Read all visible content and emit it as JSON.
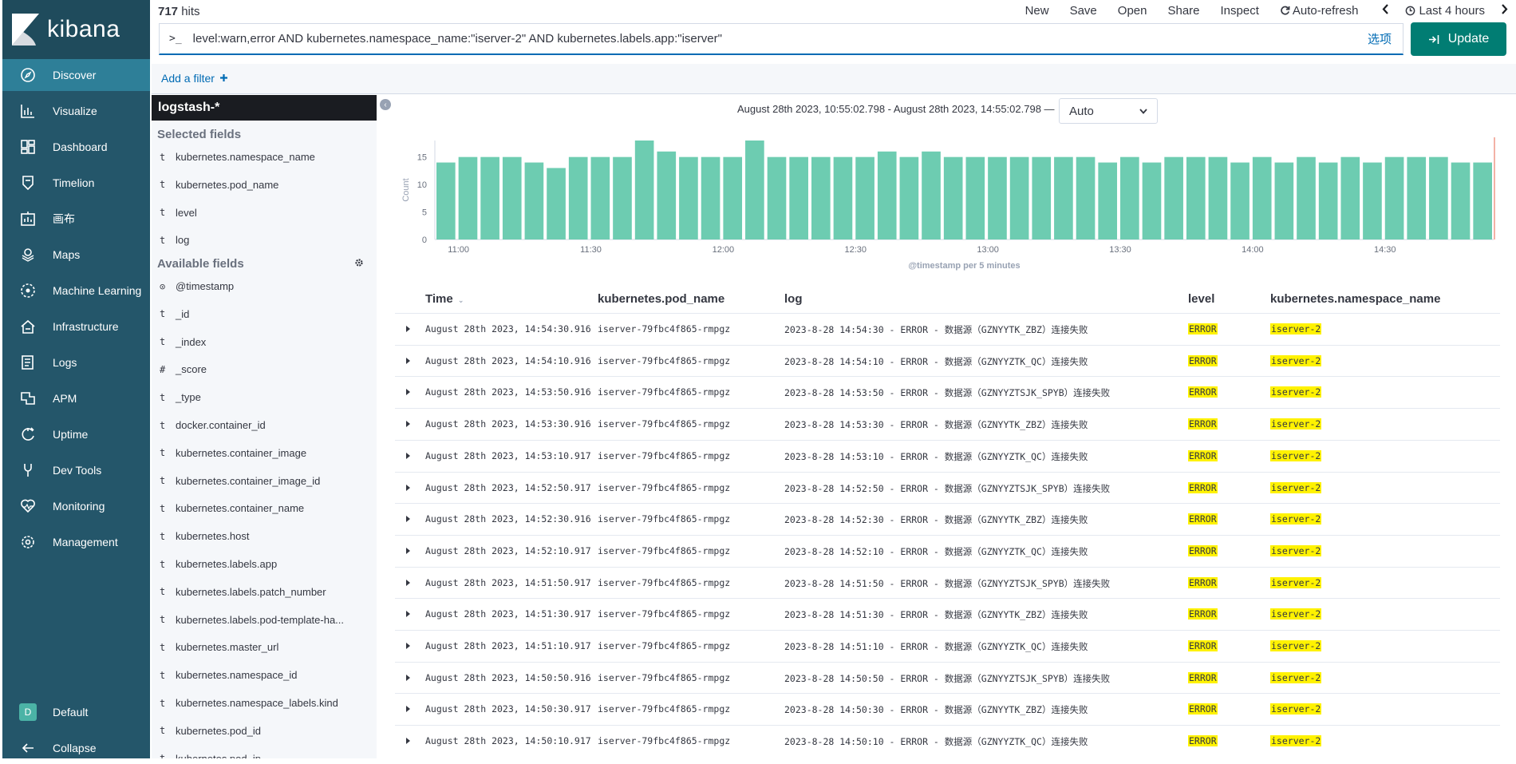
{
  "brand": "kibana",
  "nav": {
    "items": [
      {
        "label": "Discover",
        "icon": "compass-icon",
        "active": true
      },
      {
        "label": "Visualize",
        "icon": "visualize-icon"
      },
      {
        "label": "Dashboard",
        "icon": "dashboard-icon"
      },
      {
        "label": "Timelion",
        "icon": "timelion-icon"
      },
      {
        "label": "画布",
        "icon": "canvas-icon"
      },
      {
        "label": "Maps",
        "icon": "maps-icon"
      },
      {
        "label": "Machine Learning",
        "icon": "machine-learning-icon"
      },
      {
        "label": "Infrastructure",
        "icon": "infrastructure-icon"
      },
      {
        "label": "Logs",
        "icon": "logs-icon"
      },
      {
        "label": "APM",
        "icon": "apm-icon"
      },
      {
        "label": "Uptime",
        "icon": "uptime-icon"
      },
      {
        "label": "Dev Tools",
        "icon": "dev-tools-icon"
      },
      {
        "label": "Monitoring",
        "icon": "monitoring-icon"
      },
      {
        "label": "Management",
        "icon": "gear-icon"
      }
    ],
    "space_badge": "D",
    "space_label": "Default",
    "collapse_label": "Collapse"
  },
  "top": {
    "hits_count": "717",
    "hits_label": " hits",
    "menu": {
      "new": "New",
      "save": "Save",
      "open": "Open",
      "share": "Share",
      "inspect": "Inspect",
      "auto_refresh": "Auto-refresh",
      "time": "Last 4 hours"
    },
    "query_prompt": ">_",
    "query": "level:warn,error AND kubernetes.namespace_name:\"iserver-2\" AND kubernetes.labels.app:\"iserver\"",
    "options_label": "选项",
    "update_label": "Update",
    "add_filter": "Add a filter"
  },
  "sidebar": {
    "index_pattern": "logstash-*",
    "selected_title": "Selected fields",
    "selected": [
      {
        "type": "t",
        "name": "kubernetes.namespace_name"
      },
      {
        "type": "t",
        "name": "kubernetes.pod_name"
      },
      {
        "type": "t",
        "name": "level"
      },
      {
        "type": "t",
        "name": "log"
      }
    ],
    "available_title": "Available fields",
    "available": [
      {
        "type": "⊙",
        "name": "@timestamp"
      },
      {
        "type": "t",
        "name": "_id"
      },
      {
        "type": "t",
        "name": "_index"
      },
      {
        "type": "#",
        "name": "_score"
      },
      {
        "type": "t",
        "name": "_type"
      },
      {
        "type": "t",
        "name": "docker.container_id"
      },
      {
        "type": "t",
        "name": "kubernetes.container_image"
      },
      {
        "type": "t",
        "name": "kubernetes.container_image_id"
      },
      {
        "type": "t",
        "name": "kubernetes.container_name"
      },
      {
        "type": "t",
        "name": "kubernetes.host"
      },
      {
        "type": "t",
        "name": "kubernetes.labels.app"
      },
      {
        "type": "t",
        "name": "kubernetes.labels.patch_number"
      },
      {
        "type": "t",
        "name": "kubernetes.labels.pod-template-ha..."
      },
      {
        "type": "t",
        "name": "kubernetes.master_url"
      },
      {
        "type": "t",
        "name": "kubernetes.namespace_id"
      },
      {
        "type": "t",
        "name": "kubernetes.namespace_labels.kind"
      },
      {
        "type": "t",
        "name": "kubernetes.pod_id"
      },
      {
        "type": "t",
        "name": "kubernetes.pod_ip"
      }
    ]
  },
  "time_range": "August 28th 2023, 10:55:02.798 - August 28th 2023, 14:55:02.798 —",
  "interval": "Auto",
  "chart_data": {
    "type": "bar",
    "title": "",
    "xlabel": "@timestamp per 5 minutes",
    "ylabel": "Count",
    "ylim": [
      0,
      18
    ],
    "yticks": [
      0,
      5,
      10,
      15
    ],
    "xticks": [
      "11:00",
      "11:30",
      "12:00",
      "12:30",
      "13:00",
      "13:30",
      "14:00",
      "14:30"
    ],
    "xtick_index": [
      1,
      7,
      13,
      19,
      25,
      31,
      37,
      43
    ],
    "color": "#6dccb1",
    "values": [
      14,
      15,
      15,
      15,
      14,
      13,
      15,
      15,
      15,
      18,
      16,
      15,
      15,
      15,
      18,
      15,
      15,
      15,
      15,
      15,
      16,
      15,
      16,
      15,
      15,
      15,
      15,
      15,
      15,
      15,
      14,
      15,
      14,
      15,
      15,
      15,
      14,
      15,
      14,
      15,
      14,
      15,
      14,
      15,
      15,
      15,
      14,
      14
    ]
  },
  "table": {
    "headers": {
      "time": "Time",
      "pod": "kubernetes.pod_name",
      "log": "log",
      "level": "level",
      "ns": "kubernetes.namespace_name"
    },
    "rows": [
      {
        "time": "August 28th 2023, 14:54:30.916",
        "pod": "iserver-79fbc4f865-rmpgz",
        "log": "2023-8-28 14:54:30 - ERROR - 数据源（GZNYYTK_ZBZ）连接失败",
        "level": "ERROR",
        "ns": "iserver-2"
      },
      {
        "time": "August 28th 2023, 14:54:10.916",
        "pod": "iserver-79fbc4f865-rmpgz",
        "log": "2023-8-28 14:54:10 - ERROR - 数据源（GZNYYZTK_QC）连接失败",
        "level": "ERROR",
        "ns": "iserver-2"
      },
      {
        "time": "August 28th 2023, 14:53:50.916",
        "pod": "iserver-79fbc4f865-rmpgz",
        "log": "2023-8-28 14:53:50 - ERROR - 数据源（GZNYYZTSJK_SPYB）连接失败",
        "level": "ERROR",
        "ns": "iserver-2"
      },
      {
        "time": "August 28th 2023, 14:53:30.916",
        "pod": "iserver-79fbc4f865-rmpgz",
        "log": "2023-8-28 14:53:30 - ERROR - 数据源（GZNYYTK_ZBZ）连接失败",
        "level": "ERROR",
        "ns": "iserver-2"
      },
      {
        "time": "August 28th 2023, 14:53:10.917",
        "pod": "iserver-79fbc4f865-rmpgz",
        "log": "2023-8-28 14:53:10 - ERROR - 数据源（GZNYYZTK_QC）连接失败",
        "level": "ERROR",
        "ns": "iserver-2"
      },
      {
        "time": "August 28th 2023, 14:52:50.917",
        "pod": "iserver-79fbc4f865-rmpgz",
        "log": "2023-8-28 14:52:50 - ERROR - 数据源（GZNYYZTSJK_SPYB）连接失败",
        "level": "ERROR",
        "ns": "iserver-2"
      },
      {
        "time": "August 28th 2023, 14:52:30.916",
        "pod": "iserver-79fbc4f865-rmpgz",
        "log": "2023-8-28 14:52:30 - ERROR - 数据源（GZNYYTK_ZBZ）连接失败",
        "level": "ERROR",
        "ns": "iserver-2"
      },
      {
        "time": "August 28th 2023, 14:52:10.917",
        "pod": "iserver-79fbc4f865-rmpgz",
        "log": "2023-8-28 14:52:10 - ERROR - 数据源（GZNYYZTK_QC）连接失败",
        "level": "ERROR",
        "ns": "iserver-2"
      },
      {
        "time": "August 28th 2023, 14:51:50.917",
        "pod": "iserver-79fbc4f865-rmpgz",
        "log": "2023-8-28 14:51:50 - ERROR - 数据源（GZNYYZTSJK_SPYB）连接失败",
        "level": "ERROR",
        "ns": "iserver-2"
      },
      {
        "time": "August 28th 2023, 14:51:30.917",
        "pod": "iserver-79fbc4f865-rmpgz",
        "log": "2023-8-28 14:51:30 - ERROR - 数据源（GZNYYTK_ZBZ）连接失败",
        "level": "ERROR",
        "ns": "iserver-2"
      },
      {
        "time": "August 28th 2023, 14:51:10.917",
        "pod": "iserver-79fbc4f865-rmpgz",
        "log": "2023-8-28 14:51:10 - ERROR - 数据源（GZNYYZTK_QC）连接失败",
        "level": "ERROR",
        "ns": "iserver-2"
      },
      {
        "time": "August 28th 2023, 14:50:50.916",
        "pod": "iserver-79fbc4f865-rmpgz",
        "log": "2023-8-28 14:50:50 - ERROR - 数据源（GZNYYZTSJK_SPYB）连接失败",
        "level": "ERROR",
        "ns": "iserver-2"
      },
      {
        "time": "August 28th 2023, 14:50:30.917",
        "pod": "iserver-79fbc4f865-rmpgz",
        "log": "2023-8-28 14:50:30 - ERROR - 数据源（GZNYYTK_ZBZ）连接失败",
        "level": "ERROR",
        "ns": "iserver-2"
      },
      {
        "time": "August 28th 2023, 14:50:10.917",
        "pod": "iserver-79fbc4f865-rmpgz",
        "log": "2023-8-28 14:50:10 - ERROR - 数据源（GZNYYZTK_QC）连接失败",
        "level": "ERROR",
        "ns": "iserver-2"
      }
    ]
  }
}
